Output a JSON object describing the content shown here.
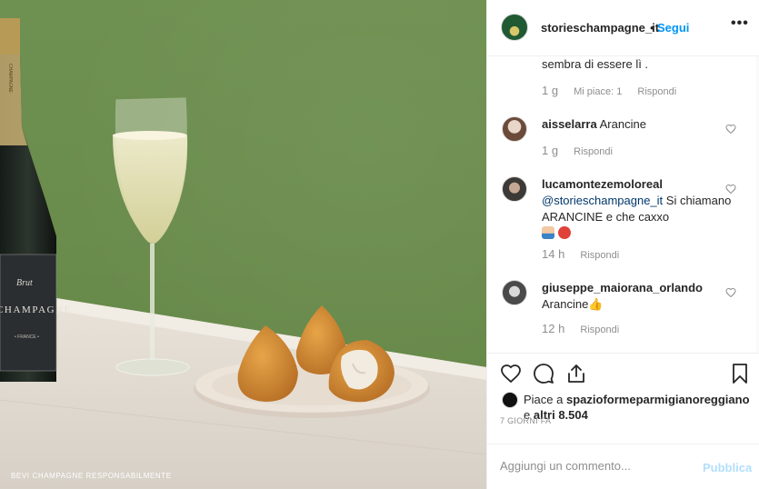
{
  "photo": {
    "disclaimer": "BEVI CHAMPAGNE RESPONSABILMENTE",
    "bottle_label_top": "CHAMPAGNE",
    "bottle_label_script": "Brut",
    "bottle_label_main": "CHAMPAGNE",
    "bottle_label_small": "• FRANCE •"
  },
  "header": {
    "username": "storieschampagne_it",
    "separator": "•",
    "follow_label": "Segui",
    "more_icon": "more-horizontal-icon"
  },
  "comments": [
    {
      "text": "sembra di essere lì .",
      "time": "1 g",
      "likes": "Mi piace: 1",
      "reply": "Rispondi"
    },
    {
      "user": "aisselarra",
      "text": "Arancine",
      "time": "1 g",
      "reply": "Rispondi"
    },
    {
      "user": "lucamontezemoloreal",
      "mention": "@storieschampagne_it",
      "text": "Si chiamano ARANCINE e che caxxo",
      "time": "14 h",
      "reply": "Rispondi"
    },
    {
      "user": "giuseppe_maiorana_orlando",
      "text": "Arancine",
      "time": "12 h",
      "reply": "Rispondi"
    }
  ],
  "actions": {
    "icons": [
      "heart-icon",
      "comment-icon",
      "share-icon",
      "bookmark-icon"
    ],
    "likes_prefix": "Piace a",
    "likes_user": "spazioformeparmigianoreggiano",
    "likes_middle": "e",
    "likes_others": "altri 8.504",
    "posted": "7 GIORNI FA"
  },
  "add_comment": {
    "placeholder": "Aggiungi un commento...",
    "post_label": "Pubblica"
  },
  "colors": {
    "accent": "#0095f6",
    "muted": "#8e8e8e",
    "wall": "#6a8c4c"
  }
}
